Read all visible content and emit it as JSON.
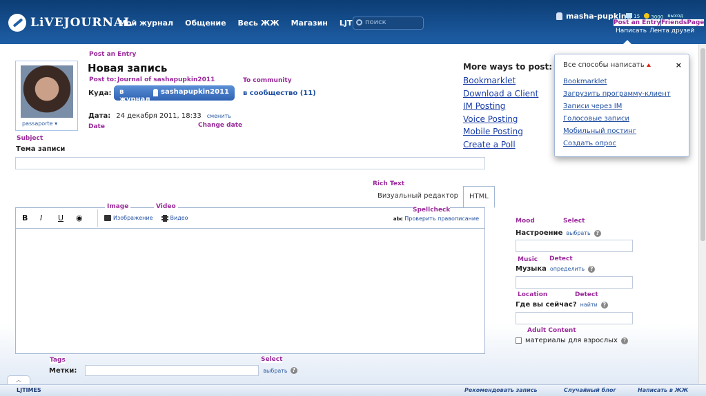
{
  "header": {
    "logo_text": "LiVEJOURNAL",
    "nav": [
      "Мой журнал",
      "Общение",
      "Весь ЖЖ",
      "Магазин",
      "LJTIMES"
    ],
    "search_placeholder": "поиск",
    "username": "masha-pupkina",
    "mail_count": "15",
    "coins": "3000",
    "logout": "выход",
    "post_link": "Написать",
    "friends_link": "Лента друзей"
  },
  "annotations": {
    "post_entry_top": "Post an Entry",
    "friends_page": "FriendsPage",
    "post_entry": "Post an Entry",
    "post_to": "Post to:",
    "journal_of": "Journal of sashapupkin2011",
    "to_community": "To community",
    "date": "Date",
    "change_date": "Change date",
    "subject": "Subject",
    "rich_text": "Rich Text",
    "image": "Image",
    "video": "Video",
    "spellcheck": "Spellcheck",
    "mood": "Mood",
    "mood_select": "Select",
    "music": "Music",
    "music_detect": "Detect",
    "location": "Location",
    "location_detect": "Detect",
    "adult": "Adult Content",
    "tags": "Tags",
    "tags_select": "Select"
  },
  "userpic": {
    "label": "passaporte ▾"
  },
  "form": {
    "title": "Новая запись",
    "dest_label": "Куда:",
    "journal_btn": "в журнал",
    "journal_user": "sashapupkin2011",
    "community_link": "в сообщество (11)",
    "date_label": "Дата:",
    "date_value": "24 декабря 2011, 18:33",
    "change_link": "сменить",
    "subject_label": "Тема записи"
  },
  "more_ways": {
    "heading": "More ways to post:",
    "links": [
      "Bookmarklet",
      "Download a Client",
      "IM Posting",
      "Voice Posting",
      "Mobile Posting",
      "Create a Poll"
    ]
  },
  "popup": {
    "title": "Все способы написать",
    "close": "×",
    "links": [
      "Bookmarklet",
      "Загрузить программу-клиент",
      "Записи через IM",
      "Голосовые записи",
      "Мобильный постинг",
      "Создать опрос"
    ]
  },
  "editor": {
    "tab_visual": "Визуальный редактор",
    "tab_html": "HTML",
    "bold": "B",
    "italic": "I",
    "underline": "U",
    "image": "Изображение",
    "video": "Видео",
    "spell_abc": "abc",
    "spellcheck": "Проверить правописание"
  },
  "side": {
    "mood_label": "Настроение",
    "mood_link": "выбрать",
    "music_label": "Музыка",
    "music_link": "определить",
    "location_label": "Где вы сейчас?",
    "location_link": "найти",
    "adult_label": "материалы для взрослых",
    "help": "?"
  },
  "tags": {
    "label": "Метки:",
    "link": "выбрать"
  },
  "footer": {
    "lj": "LJTIMES",
    "recommend": "Рекомендовать запись",
    "random": "Случайный блог",
    "write": "Написать в ЖЖ"
  }
}
